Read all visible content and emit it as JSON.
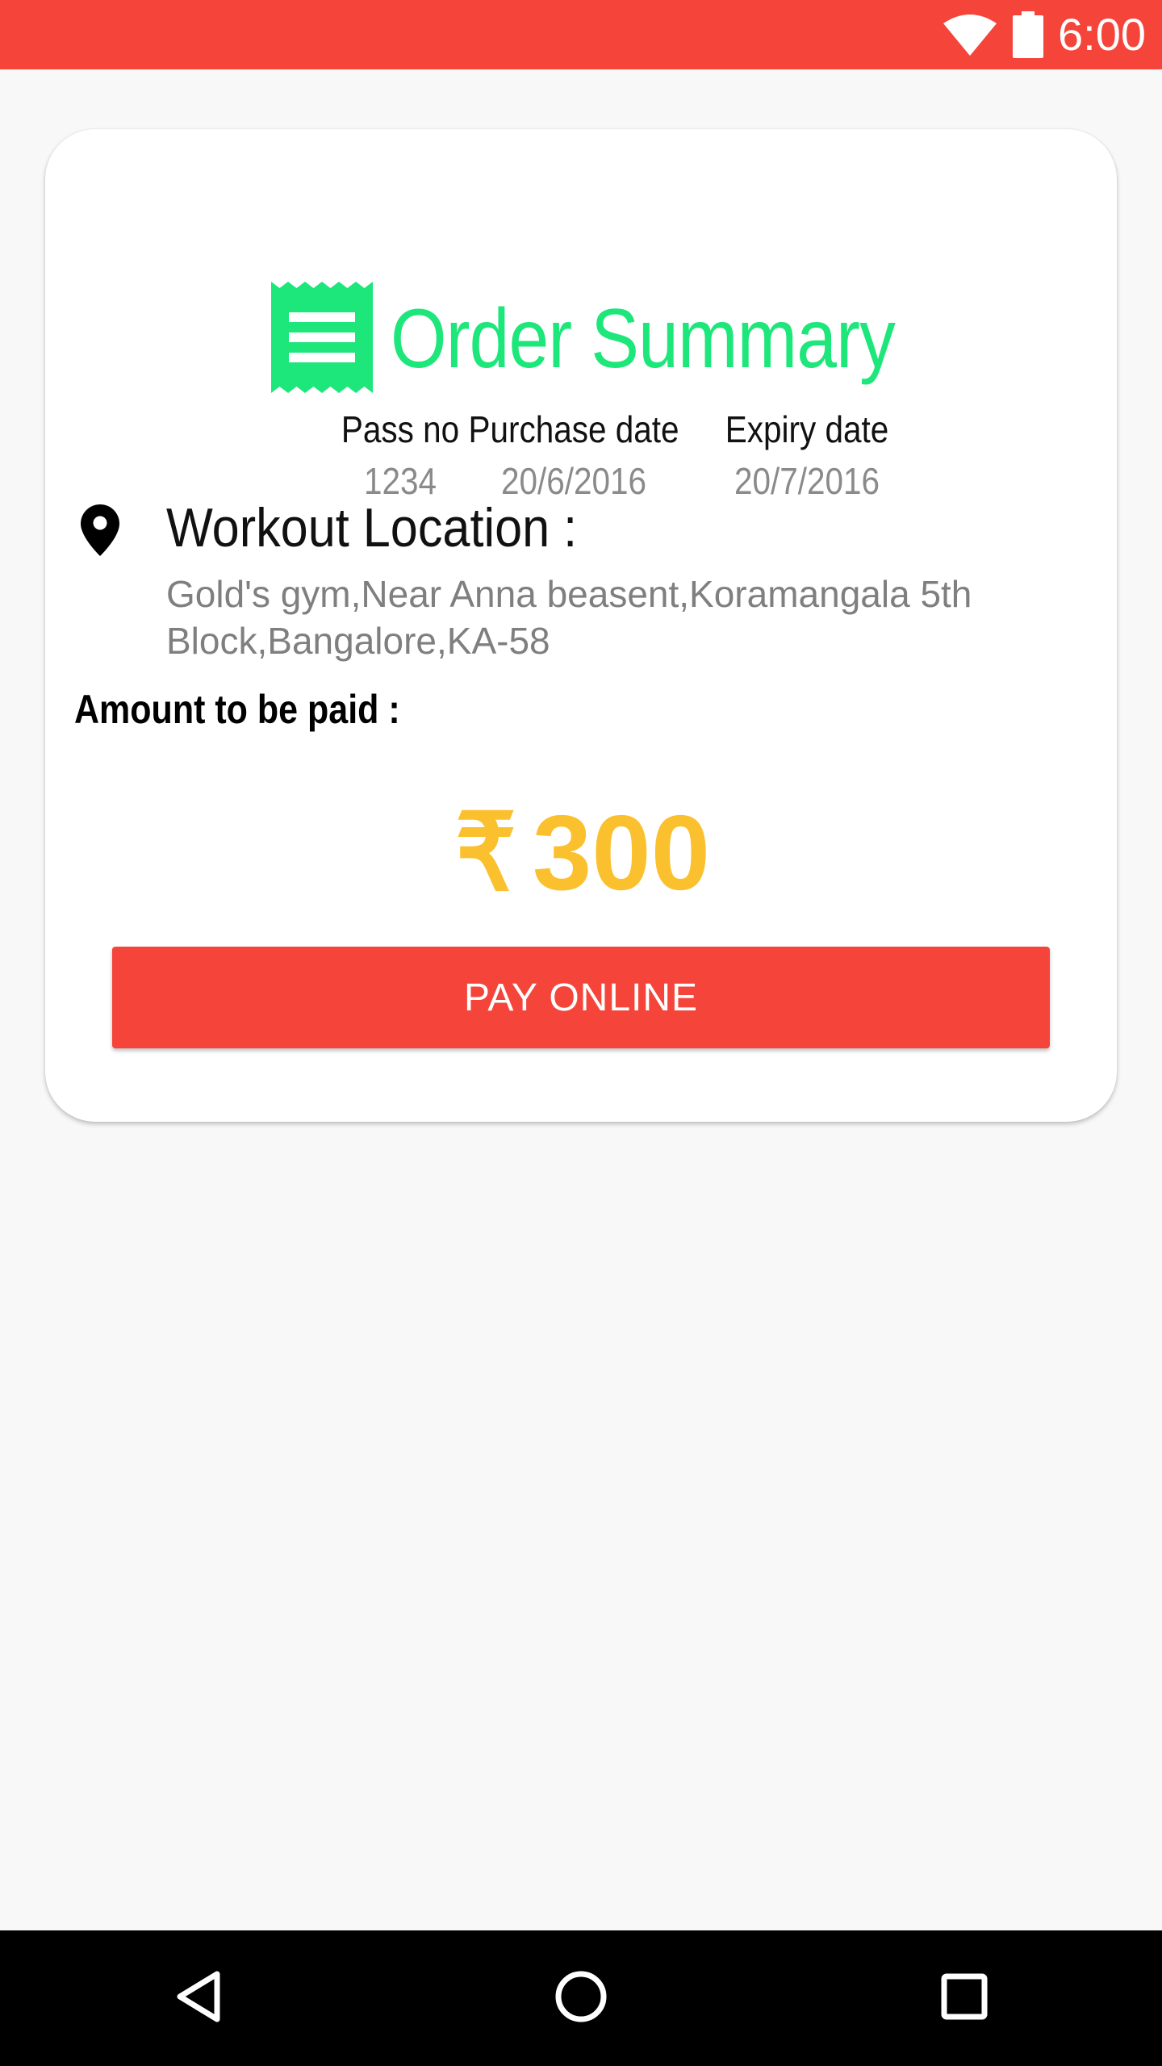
{
  "status_bar": {
    "time": "6:00",
    "icons": [
      "wifi-icon",
      "battery-icon"
    ],
    "background": "#f5453b"
  },
  "card": {
    "header": {
      "icon": "receipt-icon",
      "title": "Order Summary",
      "color": "#1de67a"
    },
    "info": [
      {
        "label": "Pass no",
        "value": "1234"
      },
      {
        "label": "Purchase date",
        "value": "20/6/2016"
      },
      {
        "label": "Expiry date",
        "value": "20/7/2016"
      }
    ],
    "location": {
      "icon": "location-pin-icon",
      "title": "Workout Location :",
      "address": "Gold's gym,Near Anna beasent,Koramangala 5th Block,Bangalore,KA-58"
    },
    "amount": {
      "label": "Amount to be paid :",
      "currency": "₹",
      "value": "300",
      "color": "#fbc02d"
    },
    "pay_button": {
      "label": "PAY ONLINE",
      "color": "#f5453b"
    }
  },
  "nav_bar": {
    "icons": [
      "back-icon",
      "home-icon",
      "recents-icon"
    ]
  }
}
